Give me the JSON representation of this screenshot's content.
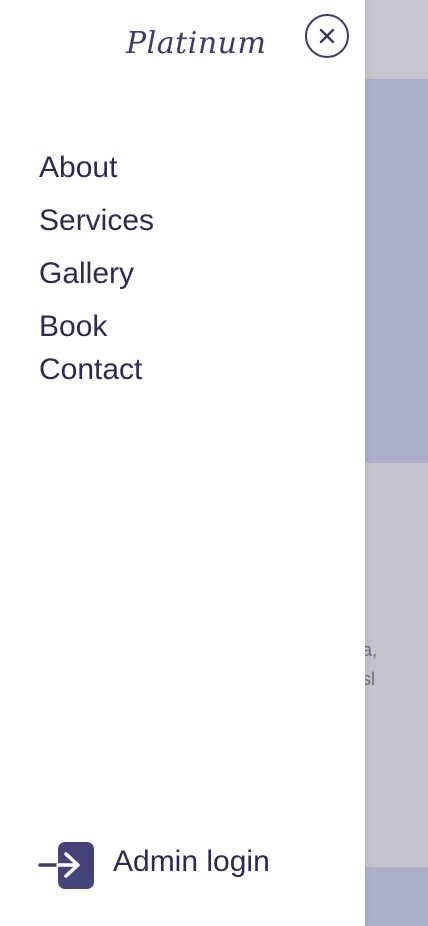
{
  "drawer": {
    "logo": "Platinum",
    "close_icon": "close-icon",
    "nav_items": [
      {
        "label": "About"
      },
      {
        "label": "Services"
      },
      {
        "label": "Gallery"
      },
      {
        "label": "Book"
      },
      {
        "label": "Contact"
      }
    ],
    "admin": {
      "label": "Admin login",
      "icon": "login-icon"
    }
  },
  "background": {
    "text_line_1": "a,",
    "text_line_2": "sl"
  },
  "colors": {
    "primary": "#3b3b63",
    "text": "#2b2b4f",
    "overlay_header": "#c4c5cf",
    "overlay_hero": "#acb0c9",
    "overlay_body": "#c3c4cd"
  }
}
